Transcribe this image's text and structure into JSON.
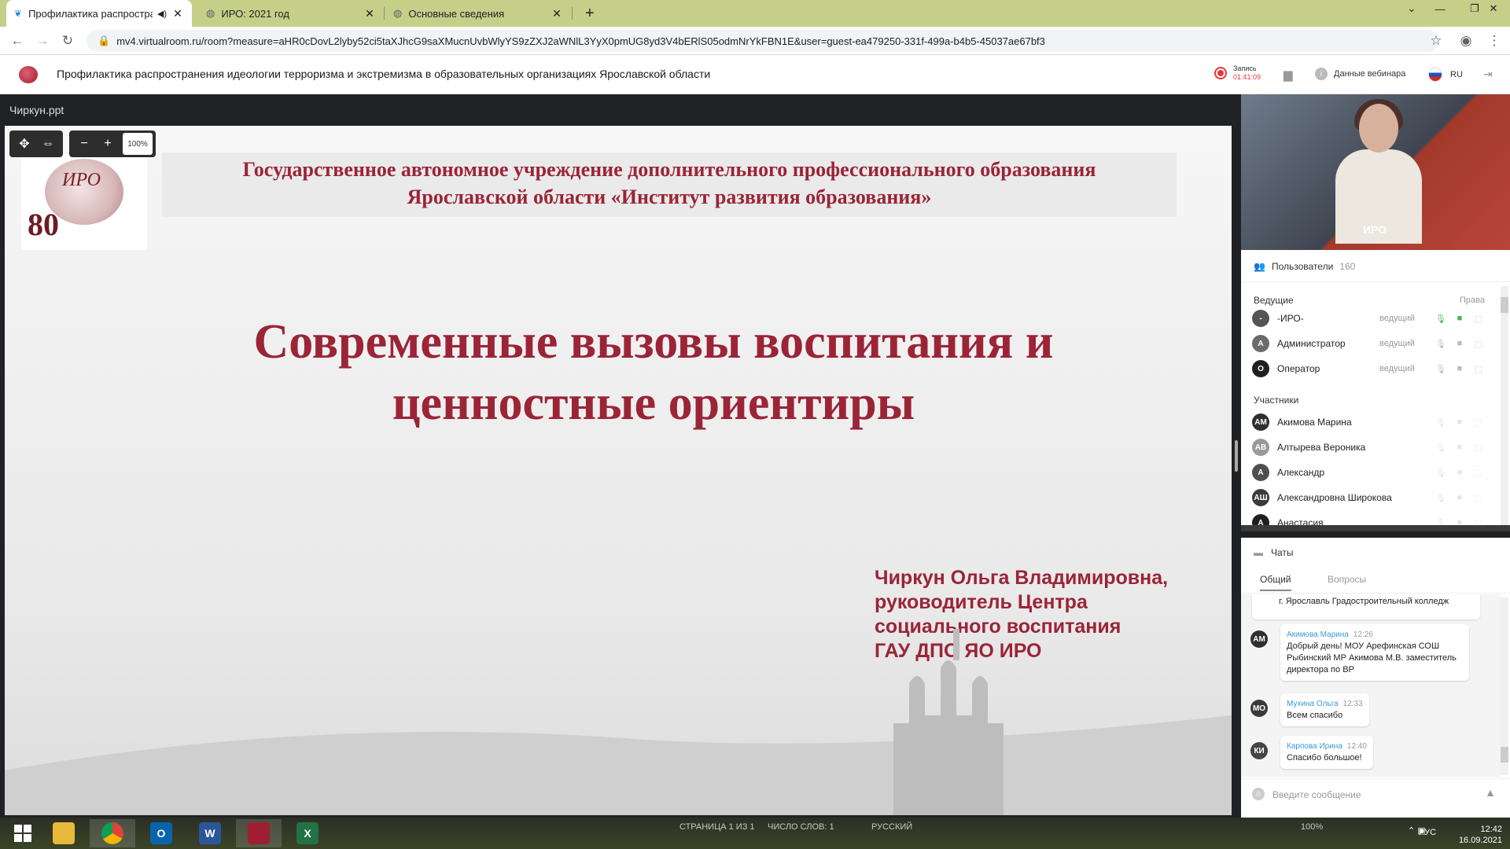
{
  "browser": {
    "tabs": [
      {
        "title": "Профилактика распростра",
        "active": true
      },
      {
        "title": "ИРО: 2021 год",
        "active": false
      },
      {
        "title": "Основные сведения",
        "active": false
      }
    ],
    "new_tab": "+",
    "url": "mv4.virtualroom.ru/room?measure=aHR0cDovL2lyby52ci5taXJhcG9saXMucnUvbWlyYS9zZXJ2aWNlL3YyX0pmUG8yd3V4bERlS05odmNrYkFBN1E&user=guest-ea479250-331f-499a-b4b5-45037ae67bf3"
  },
  "header": {
    "title": "Профилактика распространения идеологии терроризма и экстремизма в образовательных организациях Ярославской области",
    "record_label": "Запись",
    "record_time": "01:41:09",
    "webinar_data": "Данные вебинара",
    "lang": "RU"
  },
  "presentation": {
    "file_name": "Чиркун.ppt",
    "zoom": "100%",
    "slide": {
      "institution_line1": "Государственное автономное учреждение дополнительного профессионального образования",
      "institution_line2": "Ярославской области «Институт развития образования»",
      "title_line1": "Современные вызовы воспитания и",
      "title_line2": "ценностные ориентиры",
      "author_lines": [
        "Чиркун Ольга Владимировна,",
        "руководитель Центра",
        "социального воспитания",
        "ГАУ ДПО ЯО ИРО"
      ],
      "logo_number": "80",
      "logo_text": "ИРО"
    }
  },
  "video": {
    "name": "ИРО"
  },
  "users": {
    "title": "Пользователи",
    "count": "160",
    "hosts_label": "Ведущие",
    "rights_label": "Права",
    "hosts": [
      {
        "initials": "-",
        "name": "-ИРО-",
        "role": "ведущий",
        "color": "#555555"
      },
      {
        "initials": "А",
        "name": "Администратор",
        "role": "ведущий",
        "color": "#6b6b6b"
      },
      {
        "initials": "О",
        "name": "Оператор",
        "role": "ведущий",
        "color": "#1f1f1f"
      }
    ],
    "participants_label": "Участники",
    "participants": [
      {
        "initials": "АМ",
        "name": "Акимова Марина",
        "color": "#2f2f2f"
      },
      {
        "initials": "АВ",
        "name": "Алтырева Вероника",
        "color": "#9a9a9a"
      },
      {
        "initials": "А",
        "name": "Александр",
        "color": "#4f4f4f"
      },
      {
        "initials": "АШ",
        "name": "Александровна Широкова",
        "color": "#3a3a3a"
      },
      {
        "initials": "А",
        "name": "Анастасия",
        "color": "#1f1f1f"
      }
    ]
  },
  "chats": {
    "title": "Чаты",
    "tab_general": "Общий",
    "tab_questions": "Вопросы",
    "partial_message": "г. Ярославль Градостроительный колледж",
    "messages": [
      {
        "initials": "АМ",
        "author": "Акимова Марина",
        "time": "12:26",
        "text": "Добрый день! МОУ Арефинская СОШ Рыбинский МР Акимова М.В. заместитель директора по ВР",
        "color": "#2f2f2f"
      },
      {
        "initials": "МО",
        "author": "Мухина Ольга",
        "time": "12:33",
        "text": "Всем спасибо",
        "color": "#3a3a3a"
      },
      {
        "initials": "КИ",
        "author": "Карпова Ирина",
        "time": "12:40",
        "text": "Спасибо большое!",
        "color": "#444444"
      }
    ],
    "input_placeholder": "Введите сообщение"
  },
  "taskbar": {
    "status_page": "СТРАНИЦА 1 ИЗ 1",
    "status_words": "ЧИСЛО СЛОВ: 1",
    "status_lang": "РУССКИЙ",
    "status_zoom": "100%",
    "tray_lang": "РУС",
    "time": "12:42",
    "date": "16.09.2021"
  }
}
